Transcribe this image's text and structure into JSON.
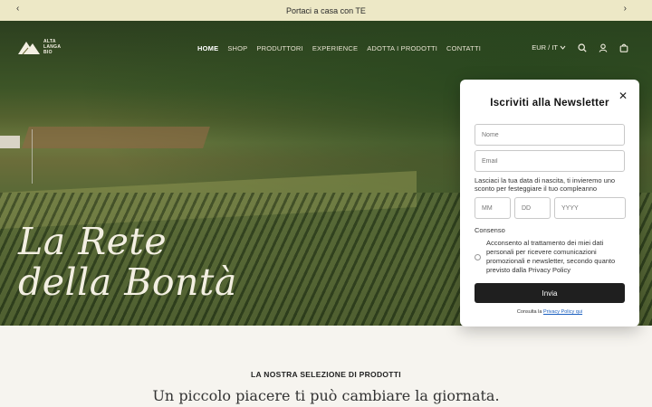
{
  "announcement": {
    "text": "Portaci a casa con TE"
  },
  "brand": {
    "logo_lines": [
      "ALTA",
      "LANGA",
      "BIO"
    ]
  },
  "nav": {
    "items": [
      "HOME",
      "SHOP",
      "PRODUTTORI",
      "EXPERIENCE",
      "ADOTTA I PRODOTTI",
      "CONTATTI"
    ],
    "active": "HOME"
  },
  "header": {
    "currency": "EUR / IT"
  },
  "hero": {
    "title_line1": "La Rete",
    "title_line2": "della Bontà"
  },
  "popup": {
    "title": "Iscriviti alla Newsletter",
    "name_placeholder": "Nome",
    "email_placeholder": "Email",
    "birthday_text": "Lasciaci la tua data di nascita, ti invieremo uno sconto per festeggiare il tuo compleanno",
    "month_placeholder": "MM",
    "day_placeholder": "DD",
    "year_placeholder": "YYYY",
    "consent_title": "Consenso",
    "consent_text": "Acconsento al trattamento dei miei dati personali per ricevere comunicazioni promozionali e newsletter, secondo quanto previsto dalla Privacy Policy",
    "submit_label": "Invia",
    "privacy_prefix": "Consulta la",
    "privacy_link": "Privacy Policy qui"
  },
  "selection": {
    "title": "LA NOSTRA SELEZIONE DI PRODOTTI",
    "subtitle": "Un piccolo piacere ti può cambiare la giornata."
  },
  "colors": {
    "announce_bg": "#ede8c6",
    "button_bg": "#1f1f1f",
    "page_bg": "#f6f4ef"
  }
}
